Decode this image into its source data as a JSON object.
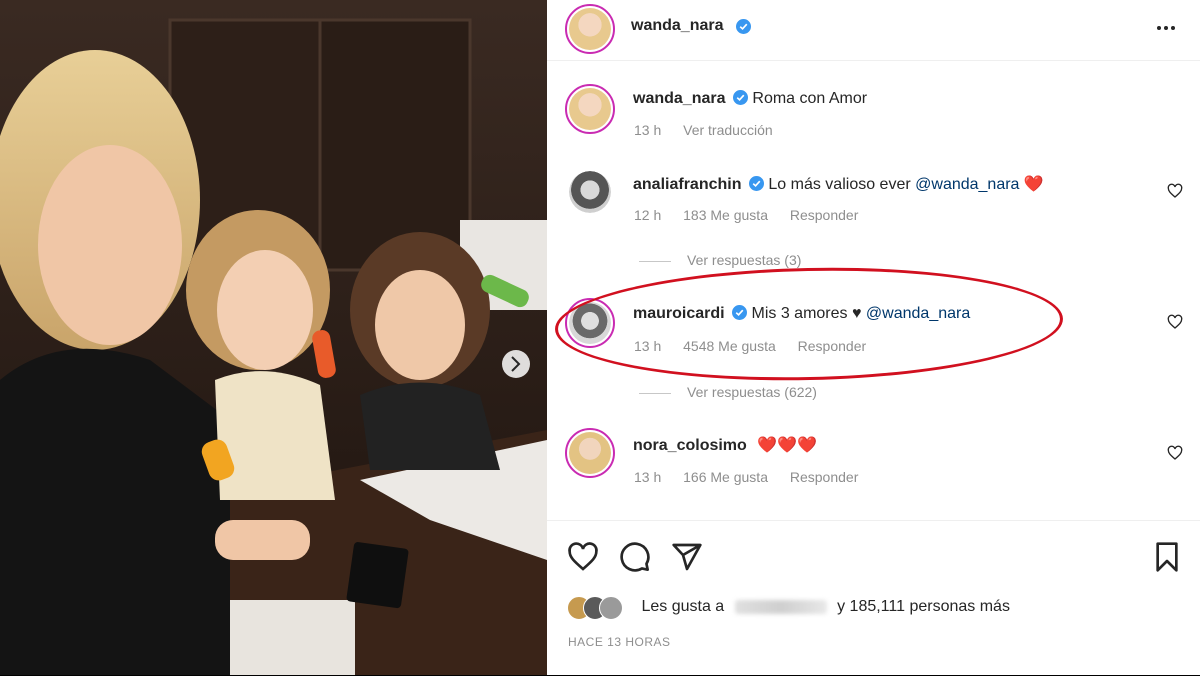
{
  "post": {
    "author": "wanda_nara",
    "more_icon": "more-horizontal-icon",
    "caption": {
      "username": "wanda_nara",
      "text": "Roma con Amor",
      "time": "13 h",
      "translate": "Ver traducción"
    }
  },
  "comments": [
    {
      "username": "analiafranchin",
      "text": "Lo más valioso ever",
      "mention": "@wanda_nara",
      "emoji": "❤️",
      "time": "12 h",
      "likes": "183 Me gusta",
      "reply": "Responder",
      "replies": "Ver respuestas (3)"
    },
    {
      "username": "mauroicardi",
      "text": "Mis 3 amores ♥",
      "mention": "@wanda_nara",
      "time": "13 h",
      "likes": "4548 Me gusta",
      "reply": "Responder",
      "replies": "Ver respuestas (622)"
    },
    {
      "username": "nora_colosimo",
      "text": "❤️❤️❤️",
      "time": "13 h",
      "likes": "166 Me gusta",
      "reply": "Responder"
    }
  ],
  "likes": {
    "prefix": "Les gusta a",
    "suffix": "y 185,111 personas más"
  },
  "timestamp": "HACE 13 HORAS",
  "colors": {
    "accent_red": "#d1101f",
    "verified_blue": "#3897f0",
    "mention_blue": "#00376b",
    "muted": "#8e8e8e"
  }
}
